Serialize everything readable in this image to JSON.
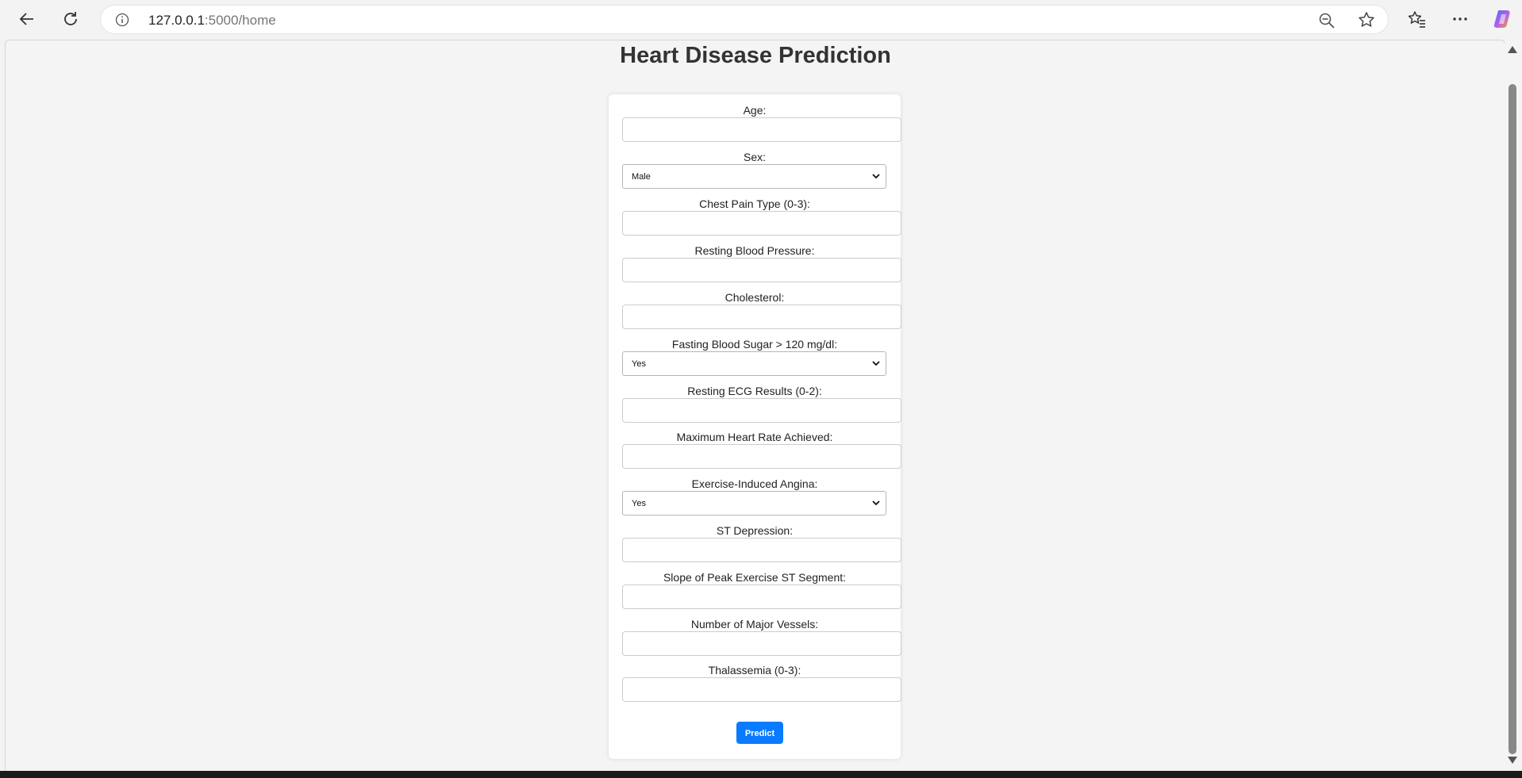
{
  "browser": {
    "url_host": "127.0.0.1",
    "url_path": ":5000/home",
    "icons": [
      "back-arrow-icon",
      "refresh-icon",
      "info-icon",
      "zoom-out-icon",
      "star-icon",
      "favorites-icon",
      "more-icon",
      "copilot-icon"
    ]
  },
  "page": {
    "title": "Heart Disease Prediction",
    "fields": [
      {
        "label": "Age:",
        "type": "input",
        "value": ""
      },
      {
        "label": "Sex:",
        "type": "select",
        "value": "Male"
      },
      {
        "label": "Chest Pain Type (0-3):",
        "type": "input",
        "value": ""
      },
      {
        "label": "Resting Blood Pressure:",
        "type": "input",
        "value": ""
      },
      {
        "label": "Cholesterol:",
        "type": "input",
        "value": ""
      },
      {
        "label": "Fasting Blood Sugar > 120 mg/dl:",
        "type": "select",
        "value": "Yes"
      },
      {
        "label": "Resting ECG Results (0-2):",
        "type": "input",
        "value": ""
      },
      {
        "label": "Maximum Heart Rate Achieved:",
        "type": "input",
        "value": ""
      },
      {
        "label": "Exercise-Induced Angina:",
        "type": "select",
        "value": "Yes"
      },
      {
        "label": "ST Depression:",
        "type": "input",
        "value": ""
      },
      {
        "label": "Slope of Peak Exercise ST Segment:",
        "type": "input",
        "value": ""
      },
      {
        "label": "Number of Major Vessels:",
        "type": "input",
        "value": ""
      },
      {
        "label": "Thalassemia (0-3):",
        "type": "input",
        "value": ""
      }
    ],
    "submit_label": "Predict"
  },
  "colors": {
    "button": "#0a7bff",
    "page_background": "#f4f4f4",
    "card_background": "#ffffff"
  }
}
